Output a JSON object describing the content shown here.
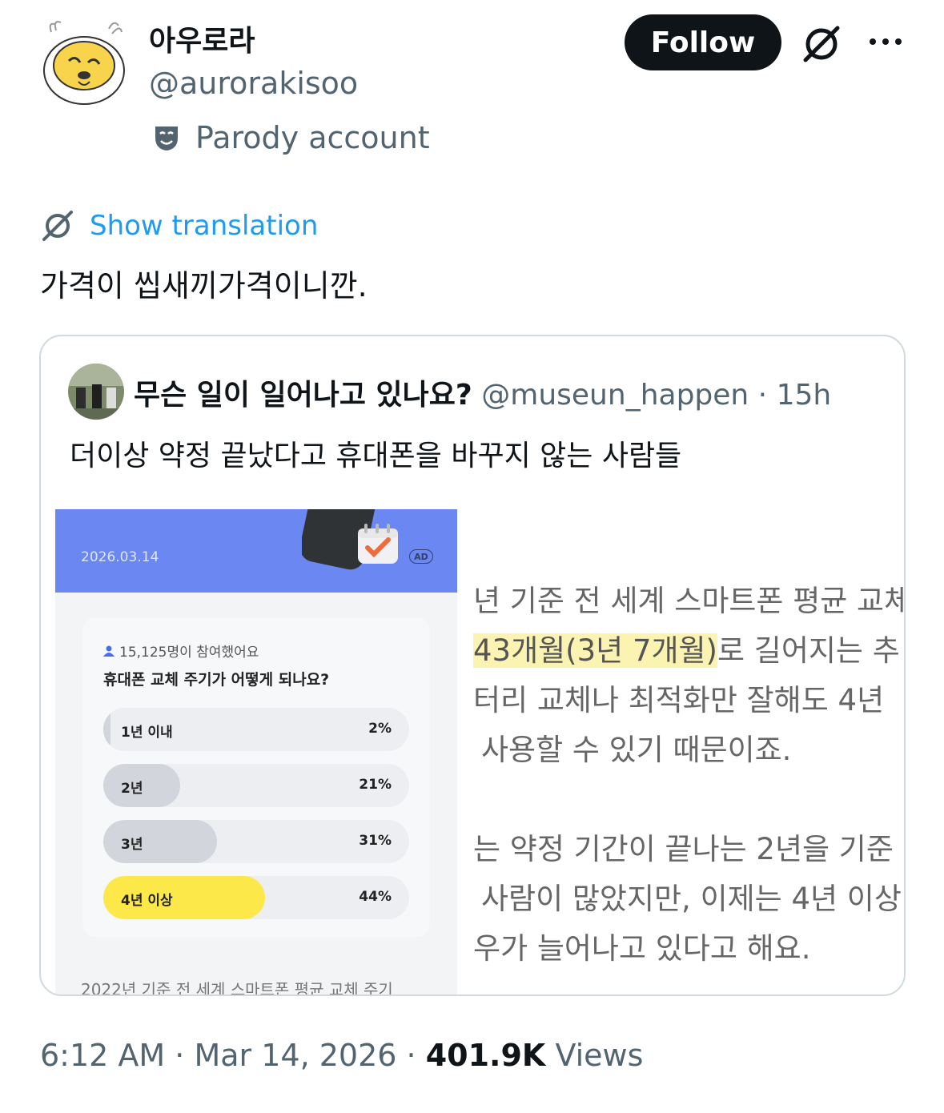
{
  "author": {
    "display_name": "아우로라",
    "handle": "@aurorakisoo",
    "parody_label": "Parody account"
  },
  "actions": {
    "follow_label": "Follow"
  },
  "tweet": {
    "translate_label": "Show translation",
    "text": "가격이 씹새끼가격이니깐."
  },
  "quote": {
    "name": "무슨 일이 일어나고 있나요?",
    "handle": "@museun_happen",
    "separator": " · ",
    "time": "15h",
    "text": "더이상 약정 끝났다고 휴대폰을 바꾸지 않는 사람들",
    "media": {
      "banner_date": "2026.03.14",
      "ad_badge": "AD",
      "poll": {
        "participants": "15,125명이 참여했어요",
        "question": "휴대폰 교체 주기가 어떻게 되나요?",
        "options": [
          {
            "label": "1년 이내",
            "percent_text": "2%",
            "value": 0.02,
            "winner": false
          },
          {
            "label": "2년",
            "percent_text": "21%",
            "value": 0.21,
            "winner": false
          },
          {
            "label": "3년",
            "percent_text": "31%",
            "value": 0.31,
            "winner": false
          },
          {
            "label": "4년 이상",
            "percent_text": "44%",
            "value": 0.44,
            "winner": true
          }
        ]
      },
      "caption": "2022년 기준 전 세계 스마트폰 평균 교체 주기",
      "article_lines": [
        "년 기준 전 세계 스마트폰 평균 교체",
        "43개월(3년 7개월)",
        "로 길어지는 추",
        "터리 교체나 최적화만 잘해도 4년",
        "사용할 수 있기 때문이죠.",
        "는 약정 기간이 끝나는 2년을 기준",
        "사람이 많았지만, 이제는 4년 이상",
        "우가 늘어나고 있다고 해요."
      ]
    }
  },
  "footer": {
    "time": "6:12 AM",
    "sep1": " · ",
    "date": "Mar 14, 2026",
    "sep2": " · ",
    "views_count": "401.9K",
    "views_label": "Views"
  },
  "colors": {
    "accent": "#1d9bf0",
    "banner": "#6b87f2",
    "poll_winner": "#fde84a"
  }
}
